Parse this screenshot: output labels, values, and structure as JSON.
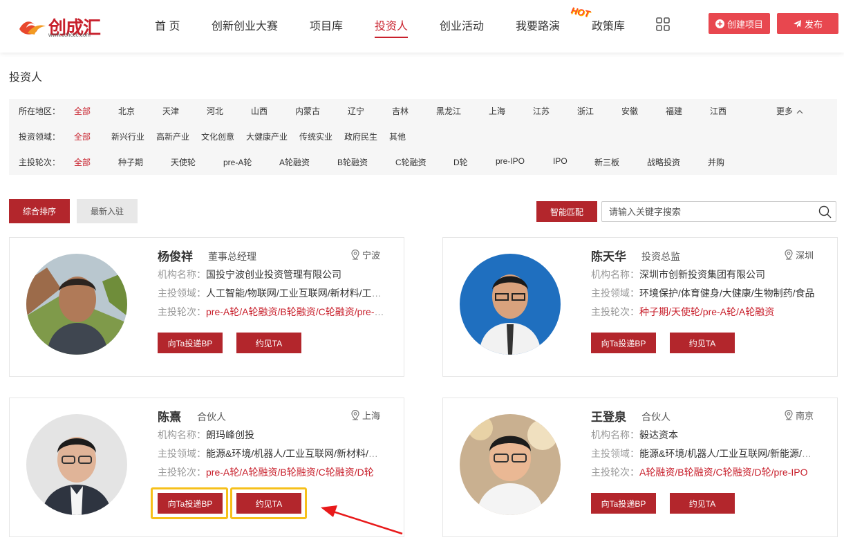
{
  "header": {
    "logo_text": "创成汇",
    "logo_sub": "www.cchccc.com",
    "nav": [
      {
        "label": "首 页"
      },
      {
        "label": "创新创业大赛"
      },
      {
        "label": "项目库"
      },
      {
        "label": "投资人"
      },
      {
        "label": "创业活动"
      },
      {
        "label": "我要路演"
      },
      {
        "label": "政策库"
      }
    ],
    "hot_badge": "HOT",
    "create_label": "创建项目",
    "publish_label": "发布"
  },
  "page_title": "投资人",
  "filters": {
    "region": {
      "label": "所在地区：",
      "options": [
        "全部",
        "北京",
        "天津",
        "河北",
        "山西",
        "内蒙古",
        "辽宁",
        "吉林",
        "黑龙江",
        "上海",
        "江苏",
        "浙江",
        "安徽",
        "福建",
        "江西"
      ],
      "more": "更多"
    },
    "field": {
      "label": "投资领域：",
      "options": [
        "全部",
        "新兴行业",
        "高新产业",
        "文化创意",
        "大健康产业",
        "传统实业",
        "政府民生",
        "其他"
      ]
    },
    "round": {
      "label": "主投轮次：",
      "options": [
        "全部",
        "种子期",
        "天使轮",
        "pre-A轮",
        "A轮融资",
        "B轮融资",
        "C轮融资",
        "D轮",
        "pre-IPO",
        "IPO",
        "新三板",
        "战略投资",
        "并购"
      ]
    }
  },
  "sort": {
    "composite": "综合排序",
    "newest": "最新入驻"
  },
  "match_label": "智能匹配",
  "search": {
    "placeholder": "请输入关键字搜索",
    "value": ""
  },
  "labels": {
    "org": "机构名称：",
    "field": "主投领域：",
    "round": "主投轮次：",
    "pitch": "向Ta投递BP",
    "meet": "约见TA"
  },
  "investors": [
    {
      "name": "杨俊祥",
      "title": "董事总经理",
      "city": "宁波",
      "org": "国投宁波创业投资管理有限公司",
      "field": "人工智能/物联网/工业互联网/新材料/工业软件",
      "round": "pre-A轮/A轮融资/B轮融资/C轮融资/pre-IPO"
    },
    {
      "name": "陈天华",
      "title": "投资总监",
      "city": "深圳",
      "org": "深圳市创新投资集团有限公司",
      "field": "环境保护/体育健身/大健康/生物制药/食品",
      "round": "种子期/天使轮/pre-A轮/A轮融资"
    },
    {
      "name": "陈熹",
      "title": "合伙人",
      "city": "上海",
      "org": "朗玛峰创投",
      "field": "能源&环境/机器人/工业互联网/新材料/新能源",
      "round": "pre-A轮/A轮融资/B轮融资/C轮融资/D轮"
    },
    {
      "name": "王登泉",
      "title": "合伙人",
      "city": "南京",
      "org": "毅达资本",
      "field": "能源&环境/机器人/工业互联网/新能源/新材料",
      "round": "A轮融资/B轮融资/C轮融资/D轮/pre-IPO"
    }
  ],
  "colors": {
    "brand": "#b3262c",
    "accent": "#c8202c",
    "highlight": "#f6c01b",
    "publish": "#e8474f"
  }
}
